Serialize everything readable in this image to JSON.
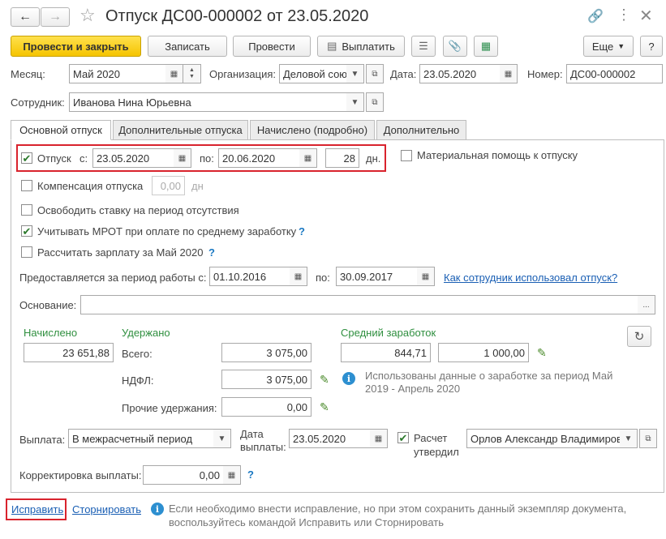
{
  "window": {
    "title": "Отпуск ДС00-000002 от 23.05.2020"
  },
  "toolbar": {
    "post_close": "Провести и закрыть",
    "save": "Записать",
    "post": "Провести",
    "pay": "Выплатить",
    "more": "Еще",
    "help": "?"
  },
  "header": {
    "month_label": "Месяц:",
    "month_value": "Май 2020",
    "org_label": "Организация:",
    "org_value": "Деловой сою",
    "date_label": "Дата:",
    "date_value": "23.05.2020",
    "number_label": "Номер:",
    "number_value": "ДС00-000002",
    "employee_label": "Сотрудник:",
    "employee_value": "Иванова Нина Юрьевна"
  },
  "tabs": [
    "Основной отпуск",
    "Дополнительные отпуска",
    "Начислено (подробно)",
    "Дополнительно"
  ],
  "vacation": {
    "label": "Отпуск",
    "from_label": "с:",
    "from": "23.05.2020",
    "to_label": "по:",
    "to": "20.06.2020",
    "days": "28",
    "days_unit": "дн.",
    "material_help": "Материальная помощь к отпуску",
    "compensation": "Компенсация отпуска",
    "comp_value": "0,00",
    "comp_unit": "дн",
    "free_rate": "Освободить ставку на период отсутствия",
    "mrot": "Учитывать МРОТ при оплате по среднему заработку",
    "calc_salary": "Рассчитать зарплату за Май 2020",
    "period_label": "Предоставляется за период работы с:",
    "period_from": "01.10.2016",
    "period_to_label": "по:",
    "period_to": "30.09.2017",
    "usage_link": "Как сотрудник использовал отпуск?",
    "basis_label": "Основание:",
    "basis_value": "",
    "basis_btn": "..."
  },
  "amounts": {
    "accrued_label": "Начислено",
    "accrued": "23 651,88",
    "withheld_label": "Удержано",
    "total_label": "Всего:",
    "total": "3 075,00",
    "ndfl_label": "НДФЛ:",
    "ndfl": "3 075,00",
    "other_label": "Прочие удержания:",
    "other": "0,00",
    "avg_label": "Средний заработок",
    "avg1": "844,71",
    "avg2": "1 000,00",
    "info_text": "Использованы данные о заработке за период Май 2019 - Апрель 2020"
  },
  "payment": {
    "label": "Выплата:",
    "value": "В межрасчетный период",
    "date_label": "Дата выплаты:",
    "date": "23.05.2020",
    "approved_label": "Расчет утвердил",
    "approved_by": "Орлов Александр Владимирович",
    "correction_label": "Корректировка выплаты:",
    "correction": "0,00"
  },
  "footer": {
    "fix": "Исправить",
    "reverse": "Сторнировать",
    "note": "Если необходимо внести исправление, но при этом сохранить данный экземпляр документа, воспользуйтесь командой Исправить или Сторнировать"
  },
  "colors": {
    "accent_yellow": "#f5c400",
    "link": "#1a5fb4",
    "green": "#2f8f3f",
    "highlight_red": "#d9232d"
  }
}
